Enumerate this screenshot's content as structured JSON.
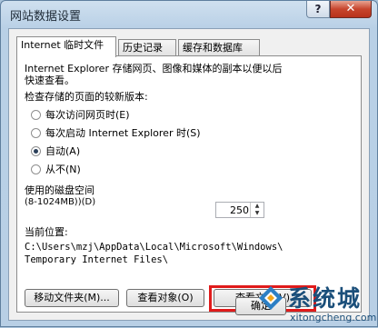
{
  "window": {
    "title": "网站数据设置",
    "help_label": "?",
    "close_label": "✕"
  },
  "tabs": [
    {
      "label": "Internet 临时文件"
    },
    {
      "label": "历史记录"
    },
    {
      "label": "缓存和数据库"
    }
  ],
  "panel": {
    "description_line1": "Internet Explorer 存储网页、图像和媒体的副本以便以后",
    "description_line2": "快速查看。",
    "check_heading": "检查存储的页面的较新版本:",
    "radio_options": [
      {
        "label": "每次访问网页时(E)",
        "selected": false
      },
      {
        "label": "每次启动 Internet Explorer 时(S)",
        "selected": false
      },
      {
        "label": "自动(A)",
        "selected": true
      },
      {
        "label": "从不(N)",
        "selected": false
      }
    ],
    "disk_space_label_line1": "使用的磁盘空间",
    "disk_space_label_line2": "(8-1024MB))(D)",
    "disk_space_value": "250",
    "location_label": "当前位置:",
    "location_line1": "C:\\Users\\mzj\\AppData\\Local\\Microsoft\\Windows\\",
    "location_line2": "Temporary Internet Files\\",
    "buttons": {
      "move_folder": "移动文件夹(M)...",
      "view_objects": "查看对象(O)",
      "view_files": "查看文件(V)"
    }
  },
  "footer": {
    "ok_label": "确定"
  },
  "watermark": {
    "text": "系统城",
    "url": "xitongcheng.com"
  },
  "colors": {
    "highlight": "#e01b1b",
    "watermark": "#1b4f7a",
    "close_button": "#c7452d"
  }
}
